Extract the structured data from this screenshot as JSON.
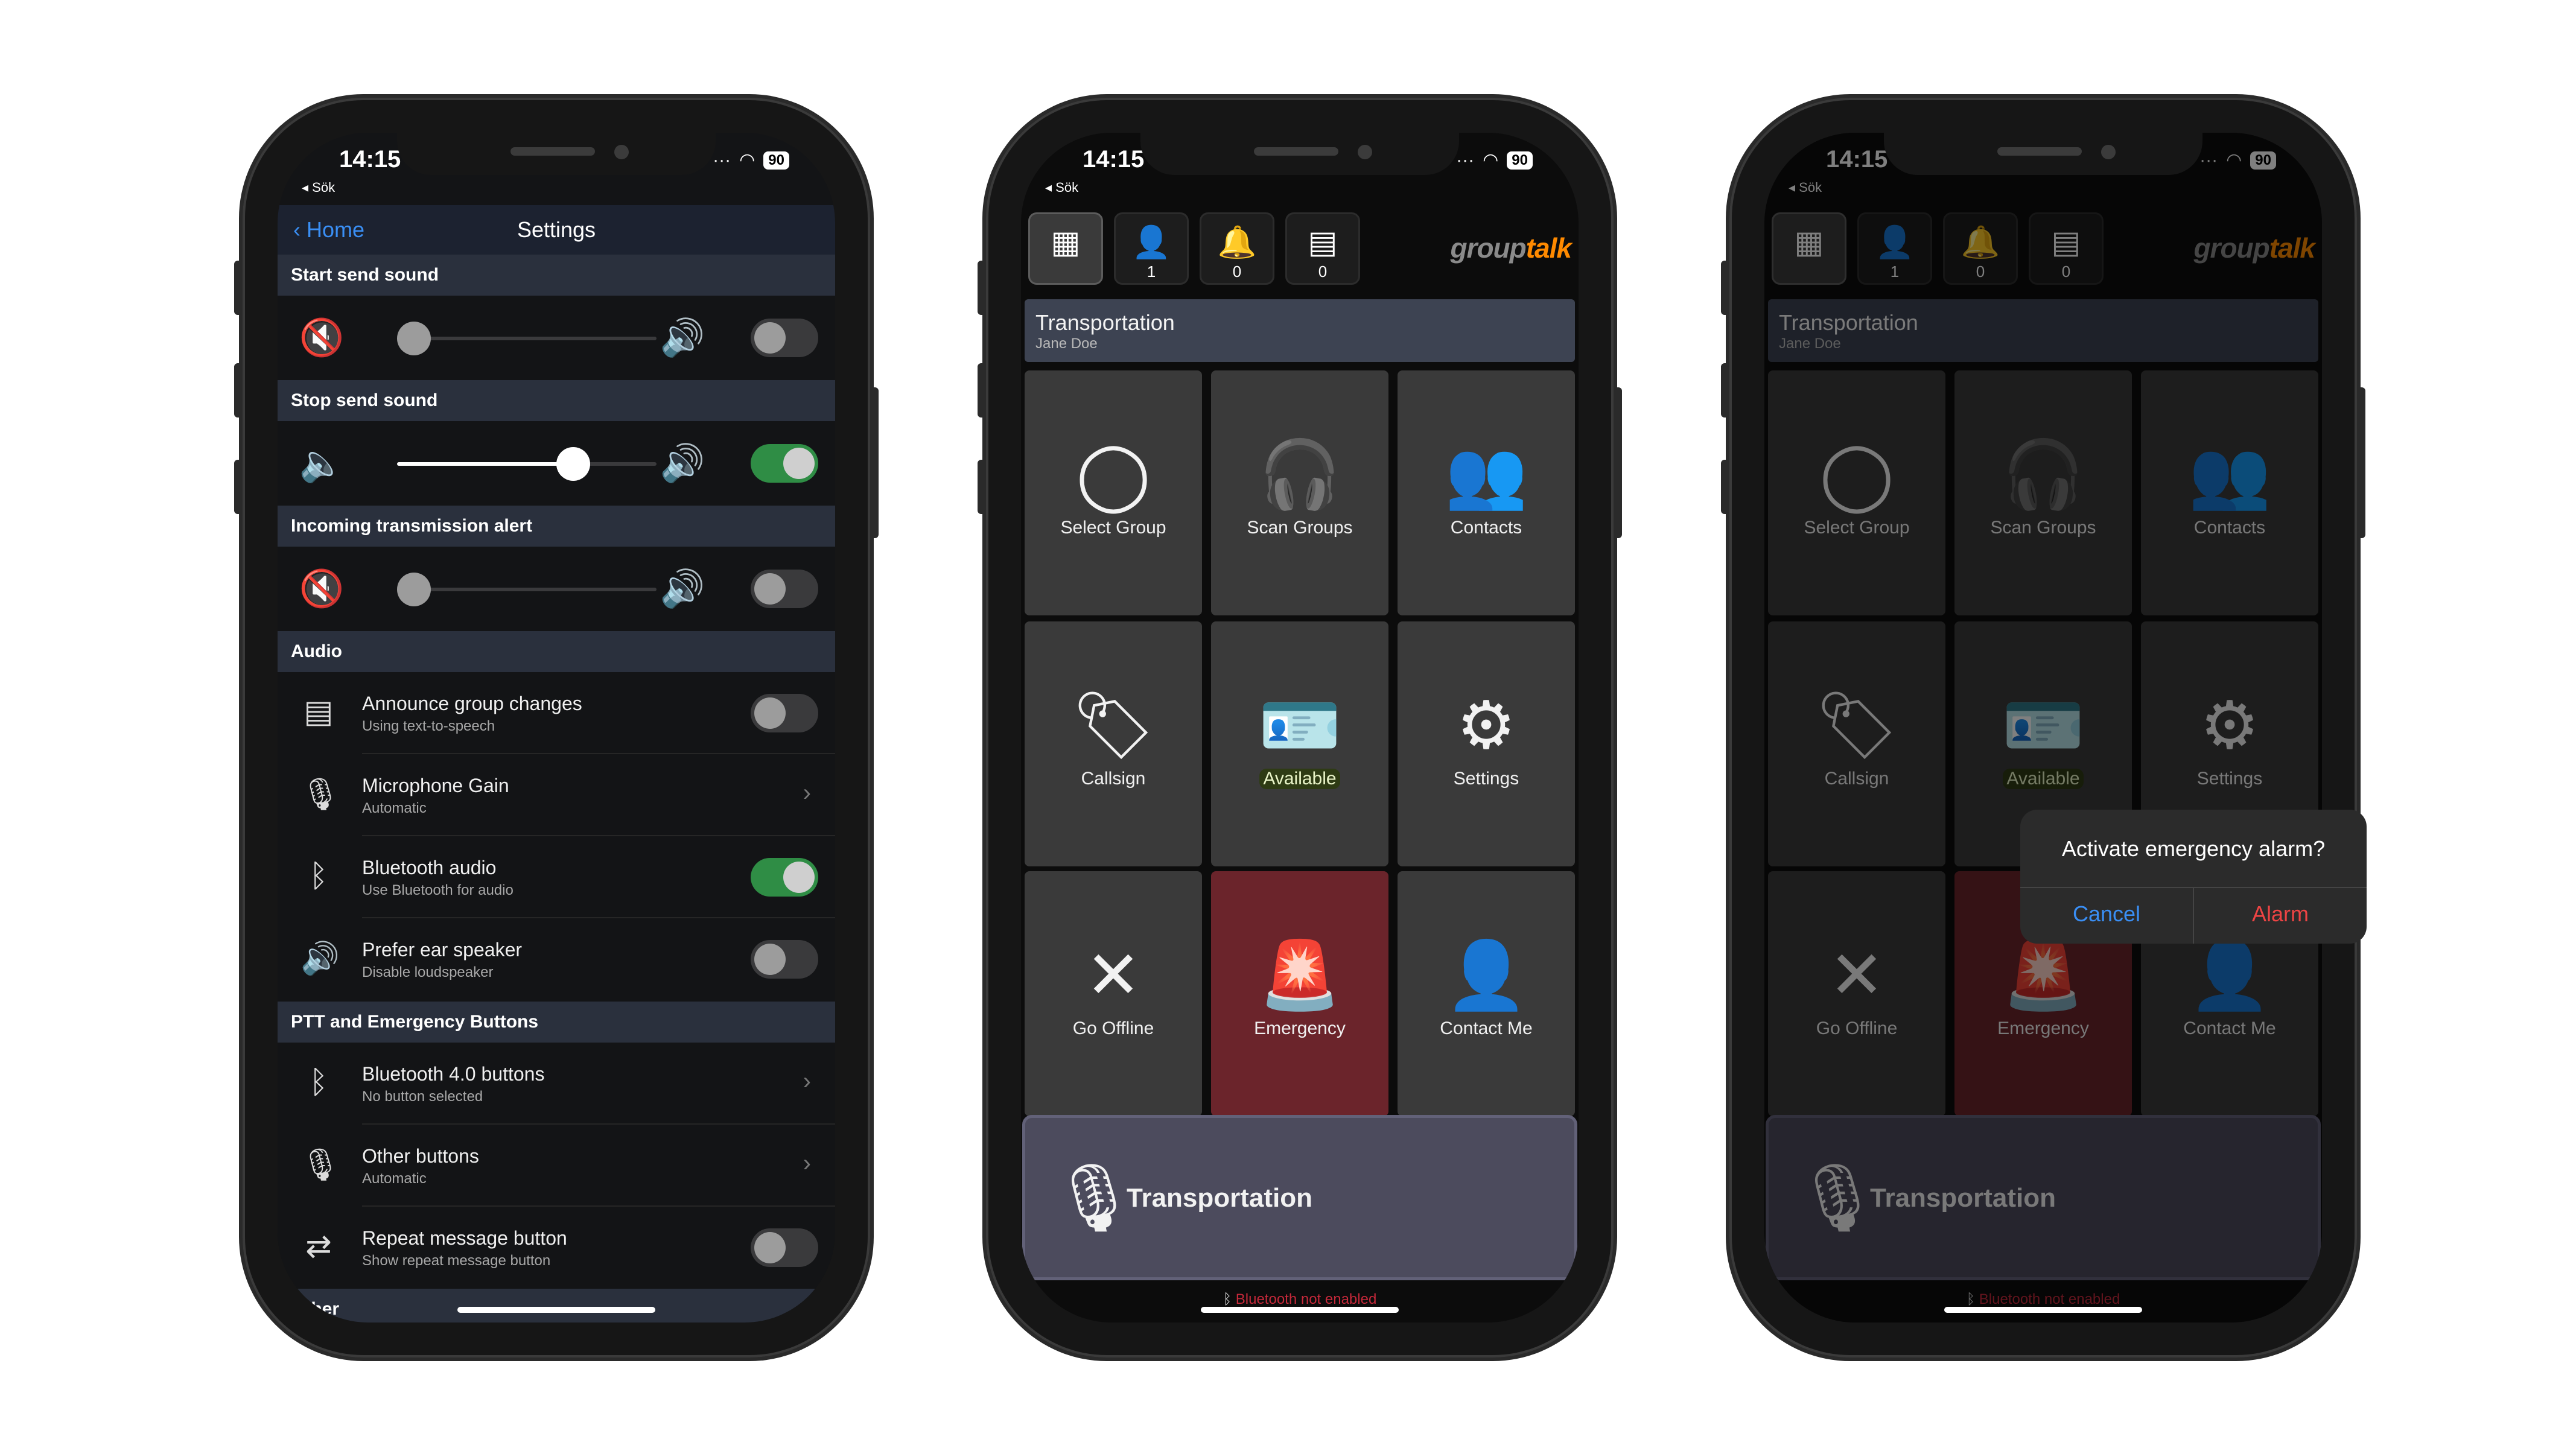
{
  "status": {
    "time": "14:15",
    "back": "◂ Sök",
    "battery": "90"
  },
  "settings": {
    "nav_back": "Home",
    "title": "Settings",
    "sections": {
      "start_send": "Start send sound",
      "stop_send": "Stop send sound",
      "incoming": "Incoming transmission alert",
      "audio": "Audio",
      "ptt": "PTT and Emergency Buttons",
      "other": "Other"
    },
    "sliders": {
      "start_send": 0.0,
      "stop_send": 0.68,
      "incoming": 0.0
    },
    "audio_rows": [
      {
        "label": "Announce group changes",
        "sub": "Using text-to-speech",
        "control": "toggle",
        "on": false
      },
      {
        "label": "Microphone Gain",
        "sub": "Automatic",
        "control": "chevron"
      },
      {
        "label": "Bluetooth audio",
        "sub": "Use Bluetooth for audio",
        "control": "toggle",
        "on": true
      },
      {
        "label": "Prefer ear speaker",
        "sub": "Disable loudspeaker",
        "control": "toggle",
        "on": false
      }
    ],
    "ptt_rows": [
      {
        "label": "Bluetooth 4.0 buttons",
        "sub": "No button selected",
        "control": "chevron"
      },
      {
        "label": "Other buttons",
        "sub": "Automatic",
        "control": "chevron"
      },
      {
        "label": "Repeat message button",
        "sub": "Show repeat message button",
        "control": "toggle",
        "on": false
      }
    ]
  },
  "main": {
    "tabs": [
      {
        "icon": "grid-icon",
        "count": ""
      },
      {
        "icon": "person-icon",
        "count": "1"
      },
      {
        "icon": "bell-icon",
        "count": "0"
      },
      {
        "icon": "message-icon",
        "count": "0"
      }
    ],
    "logo": {
      "group": "group",
      "talk": "talk"
    },
    "group_name": "Transportation",
    "user_name": "Jane Doe",
    "tiles": [
      {
        "label": "Select Group",
        "icon": "globe-icon"
      },
      {
        "label": "Scan Groups",
        "icon": "headphones-icon"
      },
      {
        "label": "Contacts",
        "icon": "people-icon"
      },
      {
        "label": "Callsign",
        "icon": "tag-icon"
      },
      {
        "label": "Available",
        "icon": "badge-icon"
      },
      {
        "label": "Settings",
        "icon": "gear-icon"
      },
      {
        "label": "Go Offline",
        "icon": "close-icon"
      },
      {
        "label": "Emergency",
        "icon": "siren-icon"
      },
      {
        "label": "Contact Me",
        "icon": "contact-clock-icon"
      }
    ],
    "ptt_label": "Transportation",
    "bluetooth_msg": "Bluetooth not enabled"
  },
  "dialog": {
    "title": "Activate emergency alarm?",
    "cancel": "Cancel",
    "confirm": "Alarm"
  },
  "colors": {
    "accent": "#3a8ff5",
    "toggle_on": "#2f8d45",
    "emergency": "#6b242b",
    "alarm": "#ee4444",
    "logo_talk": "#ff8a00"
  }
}
